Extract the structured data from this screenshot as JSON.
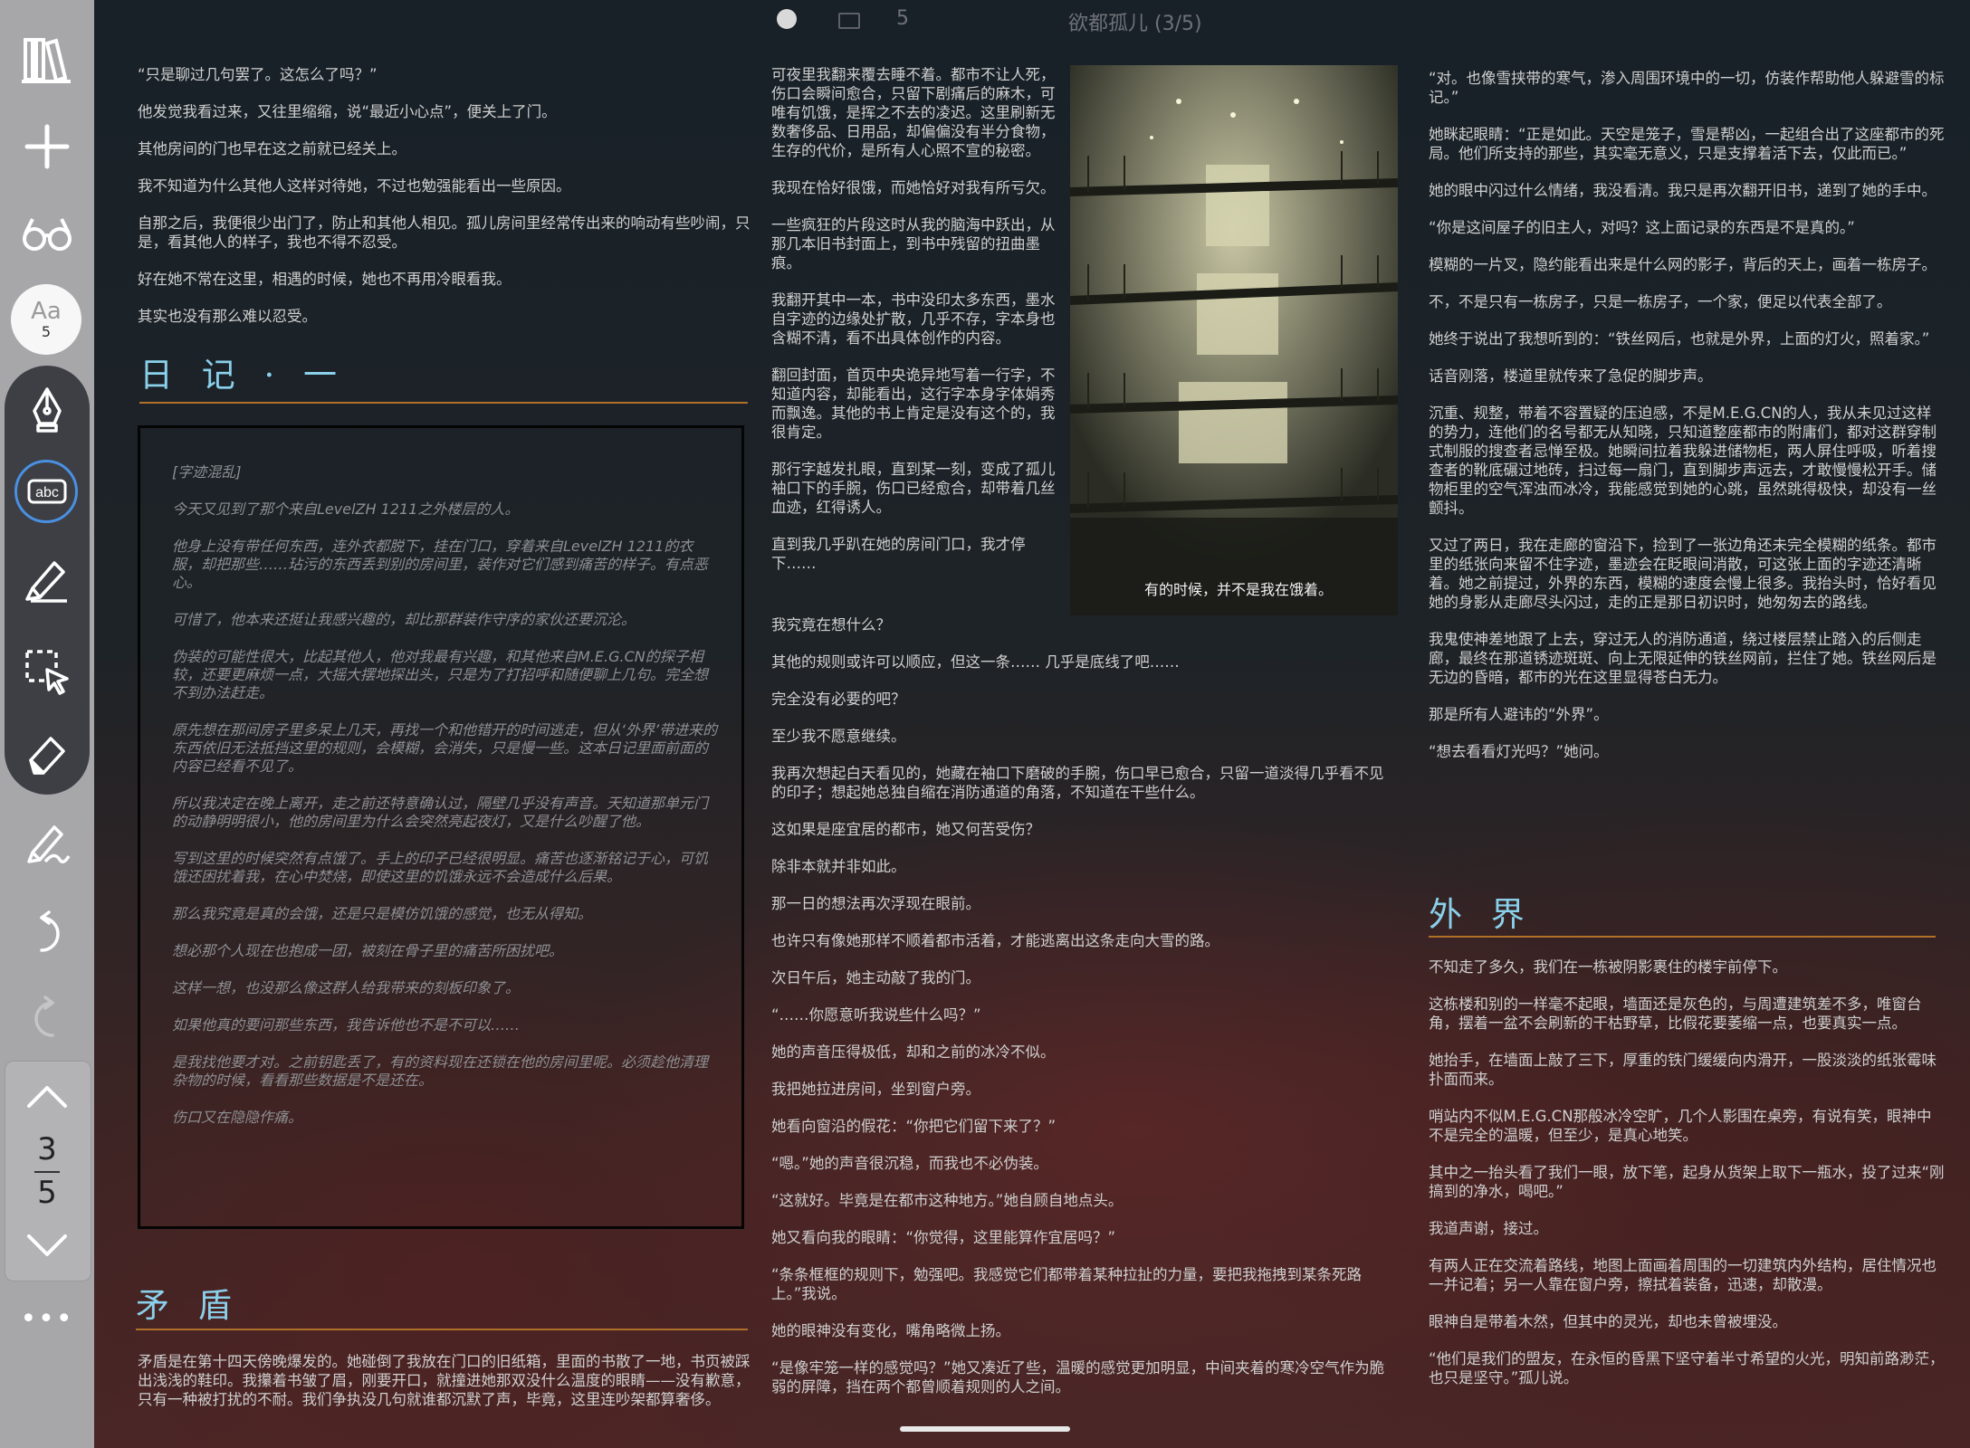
{
  "status": {
    "page_indicator": "5",
    "book_title": "欲都孤儿 (3/5)"
  },
  "sidebar": {
    "font_label": "Aa",
    "font_size": "5",
    "current_page": "3",
    "total_pages": "5",
    "more_label": "•••"
  },
  "col1": {
    "paragraphs": [
      "“只是聊过几句罢了。这怎么了吗？”",
      "他发觉我看过来，又往里缩缩，说“最近小心点”，便关上了门。",
      "其他房间的门也早在这之前就已经关上。",
      "我不知道为什么其他人这样对待她，不过也勉强能看出一些原因。",
      "自那之后，我便很少出门了，防止和其他人相见。孤儿房间里经常传出来的响动有些吵闹，只是，看其他人的样子，我也不得不忍受。",
      "好在她不常在这里，相遇的时候，她也不再用冷眼看我。",
      "其实也没有那么难以忍受。"
    ],
    "heading_diary": "日 记 · 一",
    "diary": [
      "[字迹混乱]",
      "今天又见到了那个来自LevelZH 1211之外楼层的人。",
      "他身上没有带任何东西，连外衣都脱下，挂在门口，穿着来自LevelZH 1211的衣服，却把那些……玷污的东西丢到别的房间里，装作对它们感到痛苦的样子。有点恶心。",
      "可惜了，他本来还挺让我感兴趣的，却比那群装作守序的家伙还要沉沦。",
      "伪装的可能性很大，比起其他人，他对我最有兴趣，和其他来自M.E.G.CN的探子相较，还要更麻烦一点，大摇大摆地探出头，只是为了打招呼和随便聊上几句。完全想不到办法赶走。",
      "原先想在那间房子里多呆上几天，再找一个和他错开的时间逃走，但从‘外界’带进来的东西依旧无法抵挡这里的规则，会模糊，会消失，只是慢一些。这本日记里面前面的内容已经看不见了。",
      "所以我决定在晚上离开，走之前还特意确认过，隔壁几乎没有声音。天知道那单元门的动静明明很小，他的房间里为什么会突然亮起夜灯，又是什么吵醒了他。",
      "写到这里的时候突然有点饿了。手上的印子已经很明显。痛苦也逐渐铭记于心，可饥饿还困扰着我，在心中焚烧，即使这里的饥饿永远不会造成什么后果。",
      "那么我究竟是真的会饿，还是只是模仿饥饿的感觉，也无从得知。",
      "想必那个人现在也抱成一团，被刻在骨子里的痛苦所困扰吧。",
      "这样一想，也没那么像这群人给我带来的刻板印象了。",
      "如果他真的要问那些东西，我告诉他也不是不可以……",
      "是我找他要才对。之前钥匙丢了，有的资料现在还锁在他的房间里呢。必须趁他清理杂物的时候，看看那些数据是不是还在。",
      "伤口又在隐隐作痛。"
    ],
    "heading_conflict": "矛 盾",
    "tail": "矛盾是在第十四天傍晚爆发的。她碰倒了我放在门口的旧纸箱，里面的书散了一地，书页被踩出浅浅的鞋印。我攥着书皱了眉，刚要开口，就撞进她那双没什么温度的眼睛——没有歉意，只有一种被打扰的不耐。我们争执没几句就谁都沉默了声，毕竟，这里连吵架都算奢侈。"
  },
  "col2": {
    "top_paragraphs": [
      "可夜里我翻来覆去睡不着。都市不让人死，伤口会瞬间愈合，只留下剧痛后的麻木，可唯有饥饿，是挥之不去的凌迟。这里刷新无数奢侈品、日用品，却偏偏没有半分食物，生存的代价，是所有人心照不宣的秘密。",
      "我现在恰好很饿，而她恰好对我有所亏欠。",
      "一些疯狂的片段这时从我的脑海中跃出，从那几本旧书封面上，到书中残留的扭曲墨痕。",
      "我翻开其中一本，书中没印太多东西，墨水自字迹的边缘处扩散，几乎不存，字本身也含糊不清，看不出具体创作的内容。",
      "翻回封面，首页中央诡异地写着一行字，不知道内容，却能看出，这行字本身字体娟秀而飘逸。其他的书上肯定是没有这个的，我很肯定。",
      "那行字越发扎眼，直到某一刻，变成了孤儿袖口下的手腕，伤口已经愈合，却带着几丝血迹，红得诱人。",
      "直到我几乎趴在她的房间门口，我才停下……"
    ],
    "photo_caption": "有的时候，并不是我在饿着。",
    "bottom_paragraphs": [
      "我究竟在想什么？",
      "其他的规则或许可以顺应，但这一条…… 几乎是底线了吧……",
      "完全没有必要的吧？",
      "至少我不愿意继续。",
      "我再次想起白天看见的，她藏在袖口下磨破的手腕，伤口早已愈合，只留一道淡得几乎看不见的印子；想起她总独自缩在消防通道的角落，不知道在干些什么。",
      "这如果是座宜居的都市，她又何苦受伤？",
      "除非本就并非如此。",
      "那一日的想法再次浮现在眼前。",
      "也许只有像她那样不顺着都市活着，才能逃离出这条走向大雪的路。",
      "次日午后，她主动敲了我的门。",
      "“……你愿意听我说些什么吗？”",
      "她的声音压得极低，却和之前的冰冷不似。",
      "我把她拉进房间，坐到窗户旁。",
      "她看向窗沿的假花：“你把它们留下来了？”",
      "“嗯。”她的声音很沉稳，而我也不必伪装。",
      "“这就好。毕竟是在都市这种地方。”她自顾自地点头。",
      "她又看向我的眼睛：“你觉得，这里能算作宜居吗？”",
      "“条条框框的规则下，勉强吧。我感觉它们都带着某种拉扯的力量，要把我拖拽到某条死路上。”我说。",
      "她的眼神没有变化，嘴角略微上扬。",
      "“是像牢笼一样的感觉吗？”她又凑近了些，温暖的感觉更加明显，中间夹着的寒冷空气作为脆弱的屏障，挡在两个都曾顺着规则的人之间。"
    ]
  },
  "col3": {
    "paragraphs": [
      "“对。也像雪挟带的寒气，渗入周围环境中的一切，仿装作帮助他人躲避雪的标记。”",
      "她眯起眼睛：“正是如此。天空是笼子，雪是帮凶，一起组合出了这座都市的死局。他们所支持的那些，其实毫无意义，只是支撑着活下去，仅此而已。”",
      "她的眼中闪过什么情绪，我没看清。我只是再次翻开旧书，递到了她的手中。",
      "“你是这间屋子的旧主人，对吗？这上面记录的东西是不是真的。”",
      "模糊的一片叉，隐约能看出来是什么网的影子，背后的天上，画着一栋房子。",
      "不，不是只有一栋房子，只是一栋房子，一个家，便足以代表全部了。",
      "她终于说出了我想听到的：“铁丝网后，也就是外界，上面的灯火，照着家。”",
      "话音刚落，楼道里就传来了急促的脚步声。",
      "沉重、规整，带着不容置疑的压迫感，不是M.E.G.CN的人，我从未见过这样的势力，连他们的名号都无从知晓，只知道整座都市的附庸们，都对这群穿制式制服的搜查者忌惮至极。她瞬间拉着我躲进储物柜，两人屏住呼吸，听着搜查者的靴底碾过地砖，扫过每一扇门，直到脚步声远去，才敢慢慢松开手。储物柜里的空气浑浊而冰冷，我能感觉到她的心跳，虽然跳得极快，却没有一丝颤抖。",
      "又过了两日，我在走廊的窗沿下，捡到了一张边角还未完全模糊的纸条。都市里的纸张向来留不住字迹，墨迹会在眨眼间消散，可这张上面的字迹还清晰着。她之前提过，外界的东西，模糊的速度会慢上很多。我抬头时，恰好看见她的身影从走廊尽头闪过，走的正是那日初识时，她匆匆去的路线。",
      "我鬼使神差地跟了上去，穿过无人的消防通道，绕过楼层禁止踏入的后侧走廊，最终在那道锈迹斑斑、向上无限延伸的铁丝网前，拦住了她。铁丝网后是无边的昏暗，都市的光在这里显得苍白无力。",
      "那是所有人避讳的“外界”。",
      "“想去看看灯光吗？”她问。"
    ],
    "heading_outside": "外 界",
    "tail": [
      "不知走了多久，我们在一栋被阴影裹住的楼宇前停下。",
      "这栋楼和别的一样毫不起眼，墙面还是灰色的，与周遭建筑差不多，唯窗台角，摆着一盆不会刷新的干枯野草，比假花要萎缩一点，也要真实一点。",
      "她抬手，在墙面上敲了三下，厚重的铁门缓缓向内滑开，一股淡淡的纸张霉味扑面而来。",
      "哨站内不似M.E.G.CN那般冰冷空旷，几个人影围在桌旁，有说有笑，眼神中不是完全的温暖，但至少，是真心地笑。",
      "其中之一抬头看了我们一眼，放下笔，起身从货架上取下一瓶水，投了过来“刚搞到的净水，喝吧。”",
      "我道声谢，接过。",
      "有两人正在交流着路线，地图上面画着周围的一切建筑内外结构，居住情况也一并记着；另一人靠在窗户旁，擦拭着装备，迅速，却散漫。",
      "眼神自是带着木然，但其中的灵光，却也未曾被埋没。",
      "“他们是我们的盟友，在永恒的昏黑下坚守着半寸希望的火光，明知前路渺茫，也只是坚守。”孤儿说。"
    ]
  }
}
